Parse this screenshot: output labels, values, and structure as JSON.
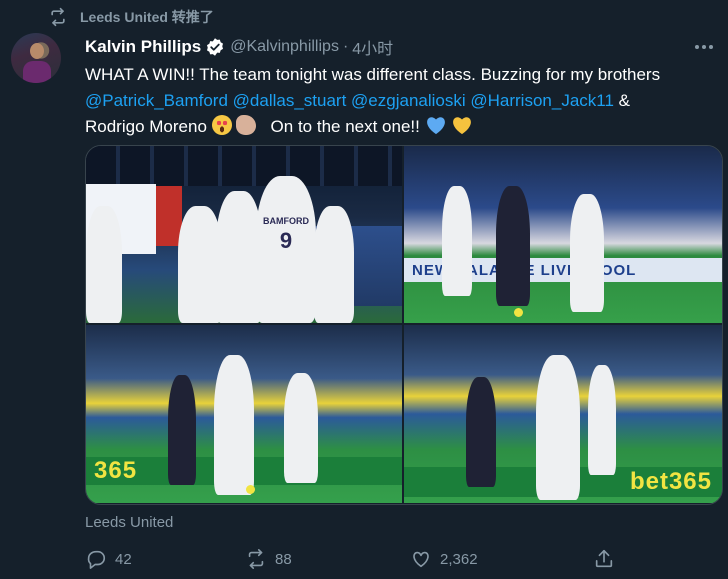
{
  "retweet": {
    "label": "Leeds United 转推了",
    "icon": "retweet-icon"
  },
  "author": {
    "display_name": "Kalvin Phillips",
    "handle": "@Kalvinphillips",
    "separator": "·",
    "time": "4小时",
    "verified_color": "#1da1f2"
  },
  "tweet": {
    "line1": "WHAT A WIN!! The team tonight was different class. Buzzing for my brothers",
    "mentions": [
      "@Patrick_Bamford",
      "@dallas_stuart",
      "@ezgjanalioski",
      "@Harrison_Jack11"
    ],
    "amp": "&",
    "line3_start": "Rodrigo Moreno",
    "line3_end": "On to the next one!!",
    "emojis": [
      "star-struck-emoji",
      "flexed-biceps-emoji",
      "blue-heart-emoji",
      "yellow-heart-emoji"
    ]
  },
  "media": {
    "photos": [
      {
        "name": "team-celebration-photo",
        "shirt_text": "BAMFORD"
      },
      {
        "name": "match-action-photo-1",
        "board_text": "NEW BALANCE LIVERPOOL"
      },
      {
        "name": "match-action-photo-2",
        "board_text": "365"
      },
      {
        "name": "match-action-photo-3",
        "board_text": "bet365"
      }
    ]
  },
  "source_label": "Leeds United",
  "actions": {
    "reply_count": "42",
    "retweet_count": "88",
    "like_count": "2,362"
  },
  "colors": {
    "background": "#15202b",
    "muted_text": "#8899a6",
    "link": "#1da1f2",
    "border": "#38444d"
  }
}
